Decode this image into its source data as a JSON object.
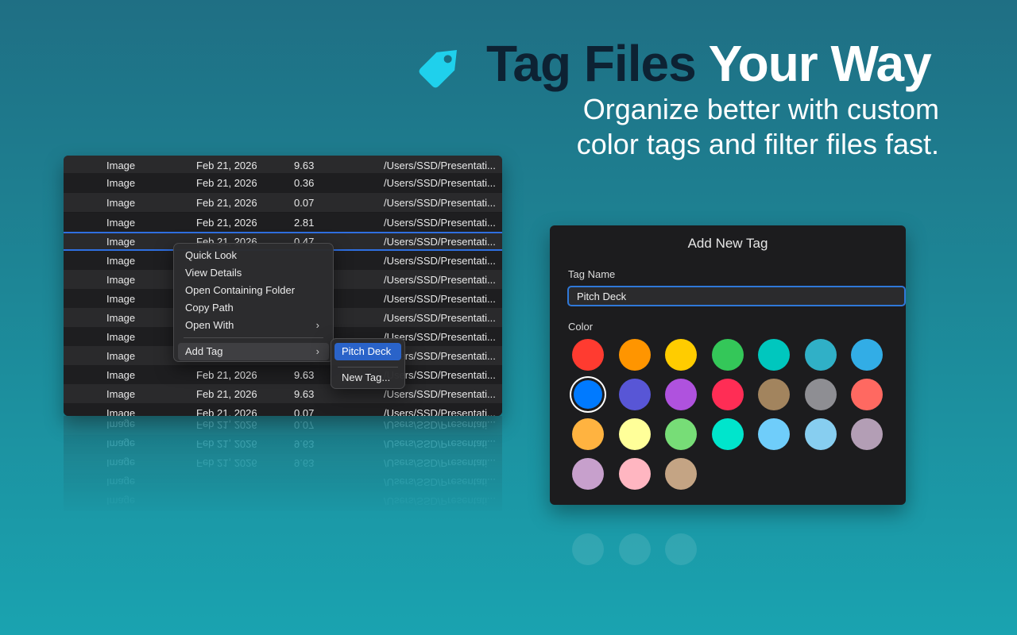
{
  "hero": {
    "title_dark": "Tag Files",
    "title_light": "Your Way",
    "subtitle_line1": "Organize better with custom",
    "subtitle_line2": "color tags and filter files fast.",
    "icon": "tag-icon",
    "icon_color": "#1fd0ec"
  },
  "files": {
    "rows": [
      {
        "kind": "Image",
        "date": "Feb 21, 2026",
        "size": "9.63",
        "path": "/Users/SSD/Presentati..."
      },
      {
        "kind": "Image",
        "date": "Feb 21, 2026",
        "size": "0.36",
        "path": "/Users/SSD/Presentati..."
      },
      {
        "kind": "Image",
        "date": "Feb 21, 2026",
        "size": "0.07",
        "path": "/Users/SSD/Presentati..."
      },
      {
        "kind": "Image",
        "date": "Feb 21, 2026",
        "size": "2.81",
        "path": "/Users/SSD/Presentati..."
      },
      {
        "kind": "Image",
        "date": "Feb 21, 2026",
        "size": "0.47",
        "path": "/Users/SSD/Presentati..."
      },
      {
        "kind": "Image",
        "date": "",
        "size": "",
        "path": "/Users/SSD/Presentati..."
      },
      {
        "kind": "Image",
        "date": "",
        "size": "",
        "path": "/Users/SSD/Presentati..."
      },
      {
        "kind": "Image",
        "date": "",
        "size": "",
        "path": "/Users/SSD/Presentati..."
      },
      {
        "kind": "Image",
        "date": "",
        "size": "",
        "path": "/Users/SSD/Presentati..."
      },
      {
        "kind": "Image",
        "date": "",
        "size": "",
        "path": "/Users/SSD/Presentati..."
      },
      {
        "kind": "Image",
        "date": "",
        "size": "",
        "path": "/Users/SSD/Presentati..."
      },
      {
        "kind": "Image",
        "date": "Feb 21, 2026",
        "size": "9.63",
        "path": "/Users/SSD/Presentati..."
      },
      {
        "kind": "Image",
        "date": "Feb 21, 2026",
        "size": "9.63",
        "path": "/Users/SSD/Presentati..."
      },
      {
        "kind": "Image",
        "date": "Feb 21, 2026",
        "size": "0.07",
        "path": "/Users/SSD/Presentati..."
      }
    ],
    "selected_row": 4
  },
  "context_menu": {
    "items": [
      "Quick Look",
      "View Details",
      "Open Containing Folder",
      "Copy Path",
      "Open With",
      "Add Tag"
    ],
    "submenu": {
      "items": [
        "Pitch Deck",
        "New Tag..."
      ],
      "active": "Pitch Deck"
    }
  },
  "tag_panel": {
    "title": "Add New Tag",
    "name_label": "Tag Name",
    "name_value": "Pitch Deck",
    "color_label": "Color",
    "selected_color_index": 7,
    "colors": [
      "#ff3b30",
      "#ff9500",
      "#ffcc00",
      "#34c759",
      "#00c7be",
      "#30b0c7",
      "#32ade6",
      "#007aff",
      "#5856d6",
      "#af52de",
      "#ff2d55",
      "#a2845e",
      "#8e8e93",
      "#ff6961",
      "#ffb340",
      "#ffff99",
      "#77dd77",
      "#00e5cc",
      "#6fcdfa",
      "#87cef0",
      "#b39eb5",
      "#c7a0cc",
      "#ffb6c1",
      "#c4a484"
    ]
  }
}
